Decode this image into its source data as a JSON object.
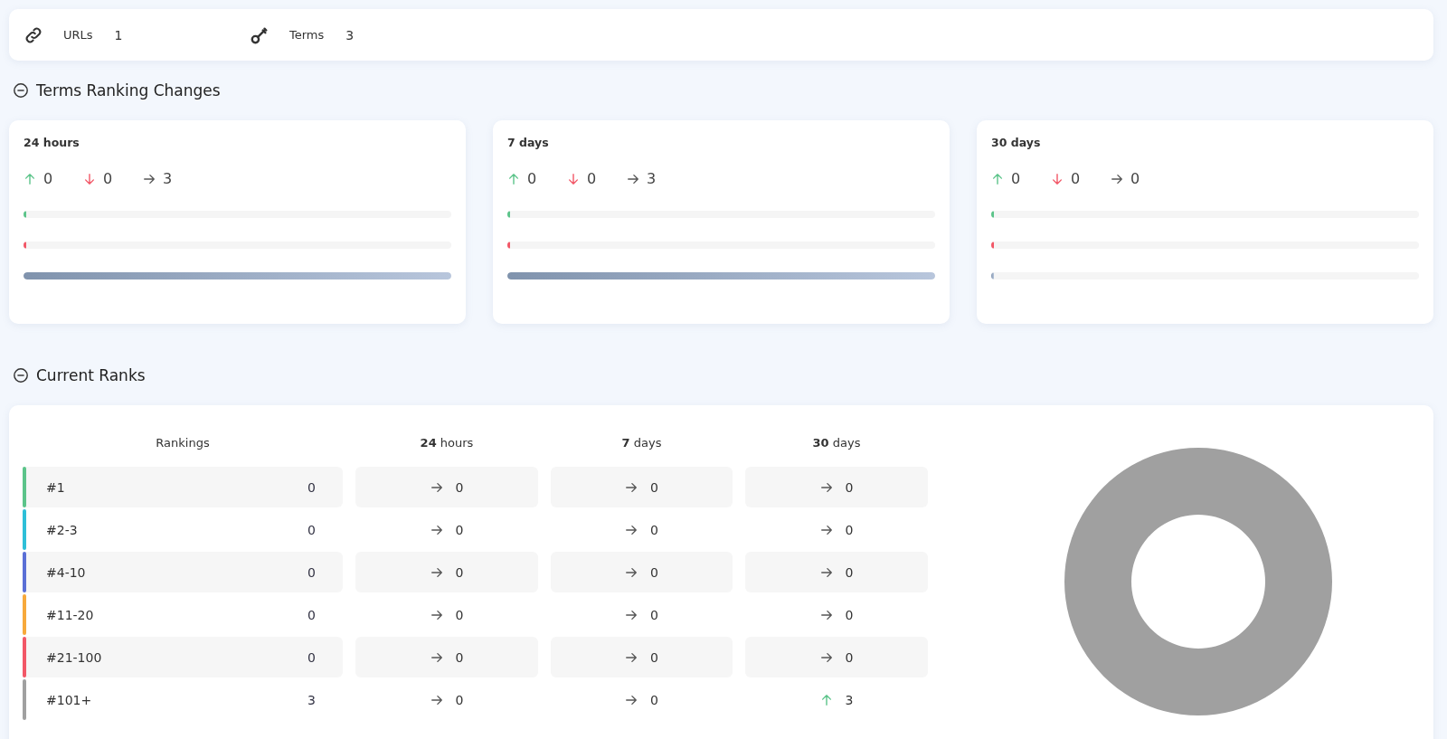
{
  "summary": [
    {
      "kind": "link",
      "label": "URLs",
      "value": "1"
    },
    {
      "kind": "key",
      "label": "Terms",
      "value": "3"
    }
  ],
  "ranking_changes": {
    "title": "Terms Ranking Changes",
    "expanded": true,
    "cards": [
      {
        "title": "24 hours",
        "up": "0",
        "down": "0",
        "flat": "3",
        "bars": [
          {
            "kind": "up",
            "level": 0
          },
          {
            "kind": "down",
            "level": 0
          },
          {
            "kind": "flat",
            "level": 1
          }
        ]
      },
      {
        "title": "7 days",
        "up": "0",
        "down": "0",
        "flat": "3",
        "bars": [
          {
            "kind": "up",
            "level": 0
          },
          {
            "kind": "down",
            "level": 0
          },
          {
            "kind": "flat",
            "level": 1
          }
        ]
      },
      {
        "title": "30 days",
        "up": "0",
        "down": "0",
        "flat": "0",
        "bars": [
          {
            "kind": "up",
            "level": 0
          },
          {
            "kind": "down",
            "level": 0
          },
          {
            "kind": "flat",
            "level": 0
          }
        ]
      }
    ]
  },
  "current_ranks": {
    "title": "Current Ranks",
    "expanded": true,
    "columns": [
      "Rankings",
      "**24** hours",
      "**7** days",
      "**30** days"
    ],
    "rows": [
      {
        "rank": "#1",
        "color": "#5cc48a",
        "count": "0",
        "changes": [
          {
            "kind": "flat",
            "value": "0"
          },
          {
            "kind": "flat",
            "value": "0"
          },
          {
            "kind": "flat",
            "value": "0"
          }
        ]
      },
      {
        "rank": "#2-3",
        "color": "#2ebfd8",
        "count": "0",
        "changes": [
          {
            "kind": "flat",
            "value": "0"
          },
          {
            "kind": "flat",
            "value": "0"
          },
          {
            "kind": "flat",
            "value": "0"
          }
        ]
      },
      {
        "rank": "#4-10",
        "color": "#5a6fd6",
        "count": "0",
        "changes": [
          {
            "kind": "flat",
            "value": "0"
          },
          {
            "kind": "flat",
            "value": "0"
          },
          {
            "kind": "flat",
            "value": "0"
          }
        ]
      },
      {
        "rank": "#11-20",
        "color": "#f7a93b",
        "count": "0",
        "changes": [
          {
            "kind": "flat",
            "value": "0"
          },
          {
            "kind": "flat",
            "value": "0"
          },
          {
            "kind": "flat",
            "value": "0"
          }
        ]
      },
      {
        "rank": "#21-100",
        "color": "#f25767",
        "count": "0",
        "changes": [
          {
            "kind": "flat",
            "value": "0"
          },
          {
            "kind": "flat",
            "value": "0"
          },
          {
            "kind": "flat",
            "value": "0"
          }
        ]
      },
      {
        "rank": "#101+",
        "color": "#a0a0a0",
        "count": "3",
        "changes": [
          {
            "kind": "flat",
            "value": "0"
          },
          {
            "kind": "flat",
            "value": "0"
          },
          {
            "kind": "up",
            "value": "3"
          }
        ]
      }
    ]
  }
}
